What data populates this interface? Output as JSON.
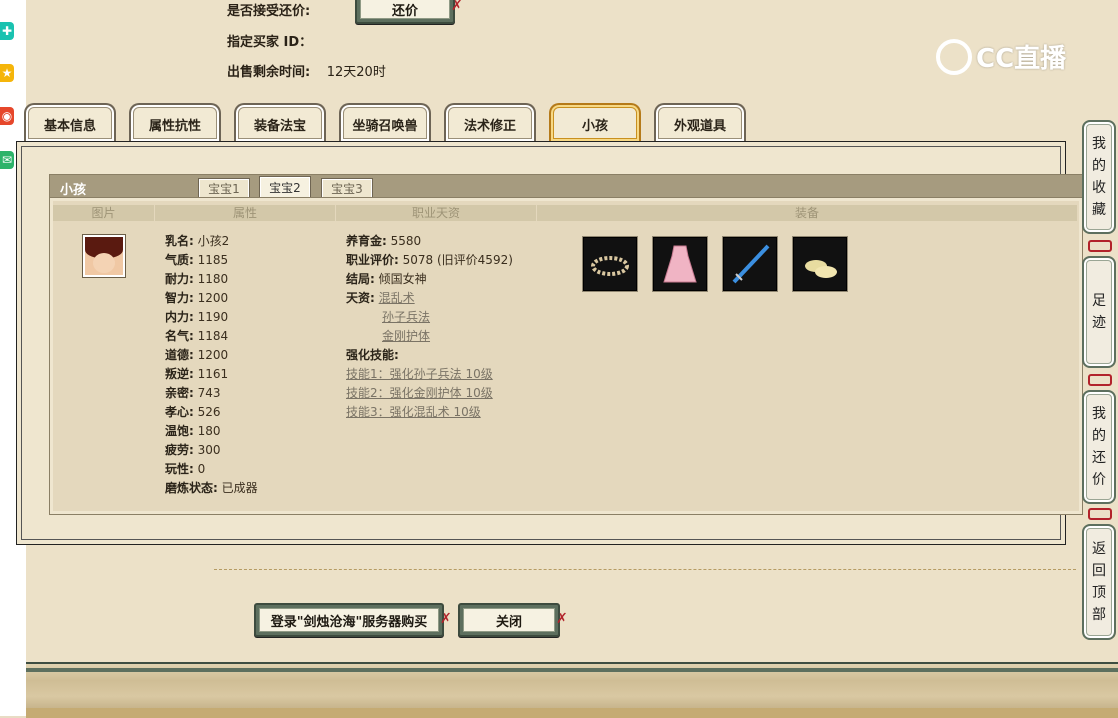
{
  "left_bar": {
    "icons": [
      {
        "name": "plus-icon",
        "color": "#19c2b0",
        "glyph": "✚"
      },
      {
        "name": "star-icon",
        "color": "#f5b50a",
        "glyph": "★"
      },
      {
        "name": "weibo-icon",
        "color": "#e6472b",
        "glyph": "◉"
      },
      {
        "name": "mail-icon",
        "color": "#2db36a",
        "glyph": "✉"
      }
    ]
  },
  "header": {
    "accept_counter_label": "是否接受还价:",
    "counter_button": "还价",
    "buyer_id_label": "指定买家 ID：",
    "buyer_id_value": "",
    "time_left_label": "出售剩余时间:",
    "time_left_value": "12天20时"
  },
  "logo": {
    "text": "CC直播"
  },
  "tabs": [
    "基本信息",
    "属性抗性",
    "装备法宝",
    "坐骑召唤兽",
    "法术修正",
    "小孩",
    "外观道具"
  ],
  "active_tab": "小孩",
  "child_panel": {
    "title": "小孩",
    "subtabs": [
      "宝宝1",
      "宝宝2",
      "宝宝3"
    ],
    "active_subtab": "宝宝2",
    "columns": [
      "图片",
      "属性",
      "职业天资",
      "装备"
    ],
    "attributes": [
      {
        "label": "乳名:",
        "value": "小孩2"
      },
      {
        "label": "气质:",
        "value": "1185"
      },
      {
        "label": "耐力:",
        "value": "1180"
      },
      {
        "label": "智力:",
        "value": "1200"
      },
      {
        "label": "内力:",
        "value": "1190"
      },
      {
        "label": "名气:",
        "value": "1184"
      },
      {
        "label": "道德:",
        "value": "1200"
      },
      {
        "label": "叛逆:",
        "value": "1161"
      },
      {
        "label": "亲密:",
        "value": "743"
      },
      {
        "label": "孝心:",
        "value": "526"
      },
      {
        "label": "温饱:",
        "value": "180"
      },
      {
        "label": "疲劳:",
        "value": "300"
      },
      {
        "label": "玩性:",
        "value": "0"
      },
      {
        "label": "磨炼状态:",
        "value": "已成器"
      }
    ],
    "career": {
      "fee_label": "养育金:",
      "fee_value": "5580",
      "rating_label": "职业评价:",
      "rating_value": "5078 (旧评价4592)",
      "ending_label": "结局:",
      "ending_value": "倾国女神",
      "talent_label": "天资:",
      "talents": [
        "混乱术",
        "孙子兵法",
        "金刚护体"
      ],
      "skills_label": "强化技能:",
      "skills": [
        "技能1：强化孙子兵法 10级",
        "技能2：强化金刚护体 10级",
        "技能3：强化混乱术 10级"
      ]
    },
    "equipment": [
      {
        "name": "wreath-icon"
      },
      {
        "name": "dress-icon"
      },
      {
        "name": "sword-icon"
      },
      {
        "name": "shoes-icon"
      }
    ]
  },
  "bottom": {
    "login_button": "登录\"剑烛沧海\"服务器购买",
    "close_button": "关闭"
  },
  "side": {
    "favorites": [
      "我",
      "的",
      "收",
      "藏"
    ],
    "footprints": [
      "足",
      "迹"
    ],
    "my_counter": [
      "我",
      "的",
      "还",
      "价"
    ],
    "back_top": [
      "返",
      "回",
      "顶",
      "部"
    ]
  }
}
